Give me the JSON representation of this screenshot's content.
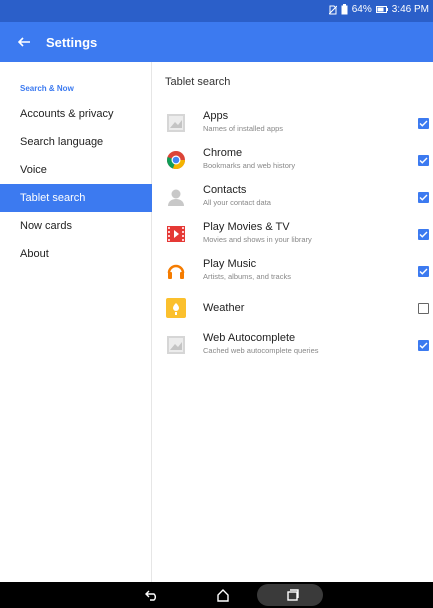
{
  "status": {
    "battery": "64%",
    "time": "3:46 PM"
  },
  "app_bar": {
    "title": "Settings"
  },
  "sidebar": {
    "header": "Search & Now",
    "items": [
      {
        "label": "Accounts & privacy"
      },
      {
        "label": "Search language"
      },
      {
        "label": "Voice"
      },
      {
        "label": "Tablet search",
        "active": true
      },
      {
        "label": "Now cards"
      },
      {
        "label": "About"
      }
    ]
  },
  "content": {
    "title": "Tablet search",
    "rows": [
      {
        "title": "Apps",
        "subtitle": "Names of installed apps",
        "checked": true,
        "icon": "apps-icon"
      },
      {
        "title": "Chrome",
        "subtitle": "Bookmarks and web history",
        "checked": true,
        "icon": "chrome-icon"
      },
      {
        "title": "Contacts",
        "subtitle": "All your contact data",
        "checked": true,
        "icon": "contacts-icon"
      },
      {
        "title": "Play Movies & TV",
        "subtitle": "Movies and shows in your library",
        "checked": true,
        "icon": "play-movies-icon"
      },
      {
        "title": "Play Music",
        "subtitle": "Artists, albums, and tracks",
        "checked": true,
        "icon": "play-music-icon"
      },
      {
        "title": "Weather",
        "subtitle": "",
        "checked": false,
        "icon": "weather-icon"
      },
      {
        "title": "Web Autocomplete",
        "subtitle": "Cached web autocomplete queries",
        "checked": true,
        "icon": "web-autocomplete-icon"
      }
    ]
  },
  "colors": {
    "accent": "#3c7af0",
    "status_bar": "#2b5fc9",
    "nav_bar": "#000000"
  }
}
